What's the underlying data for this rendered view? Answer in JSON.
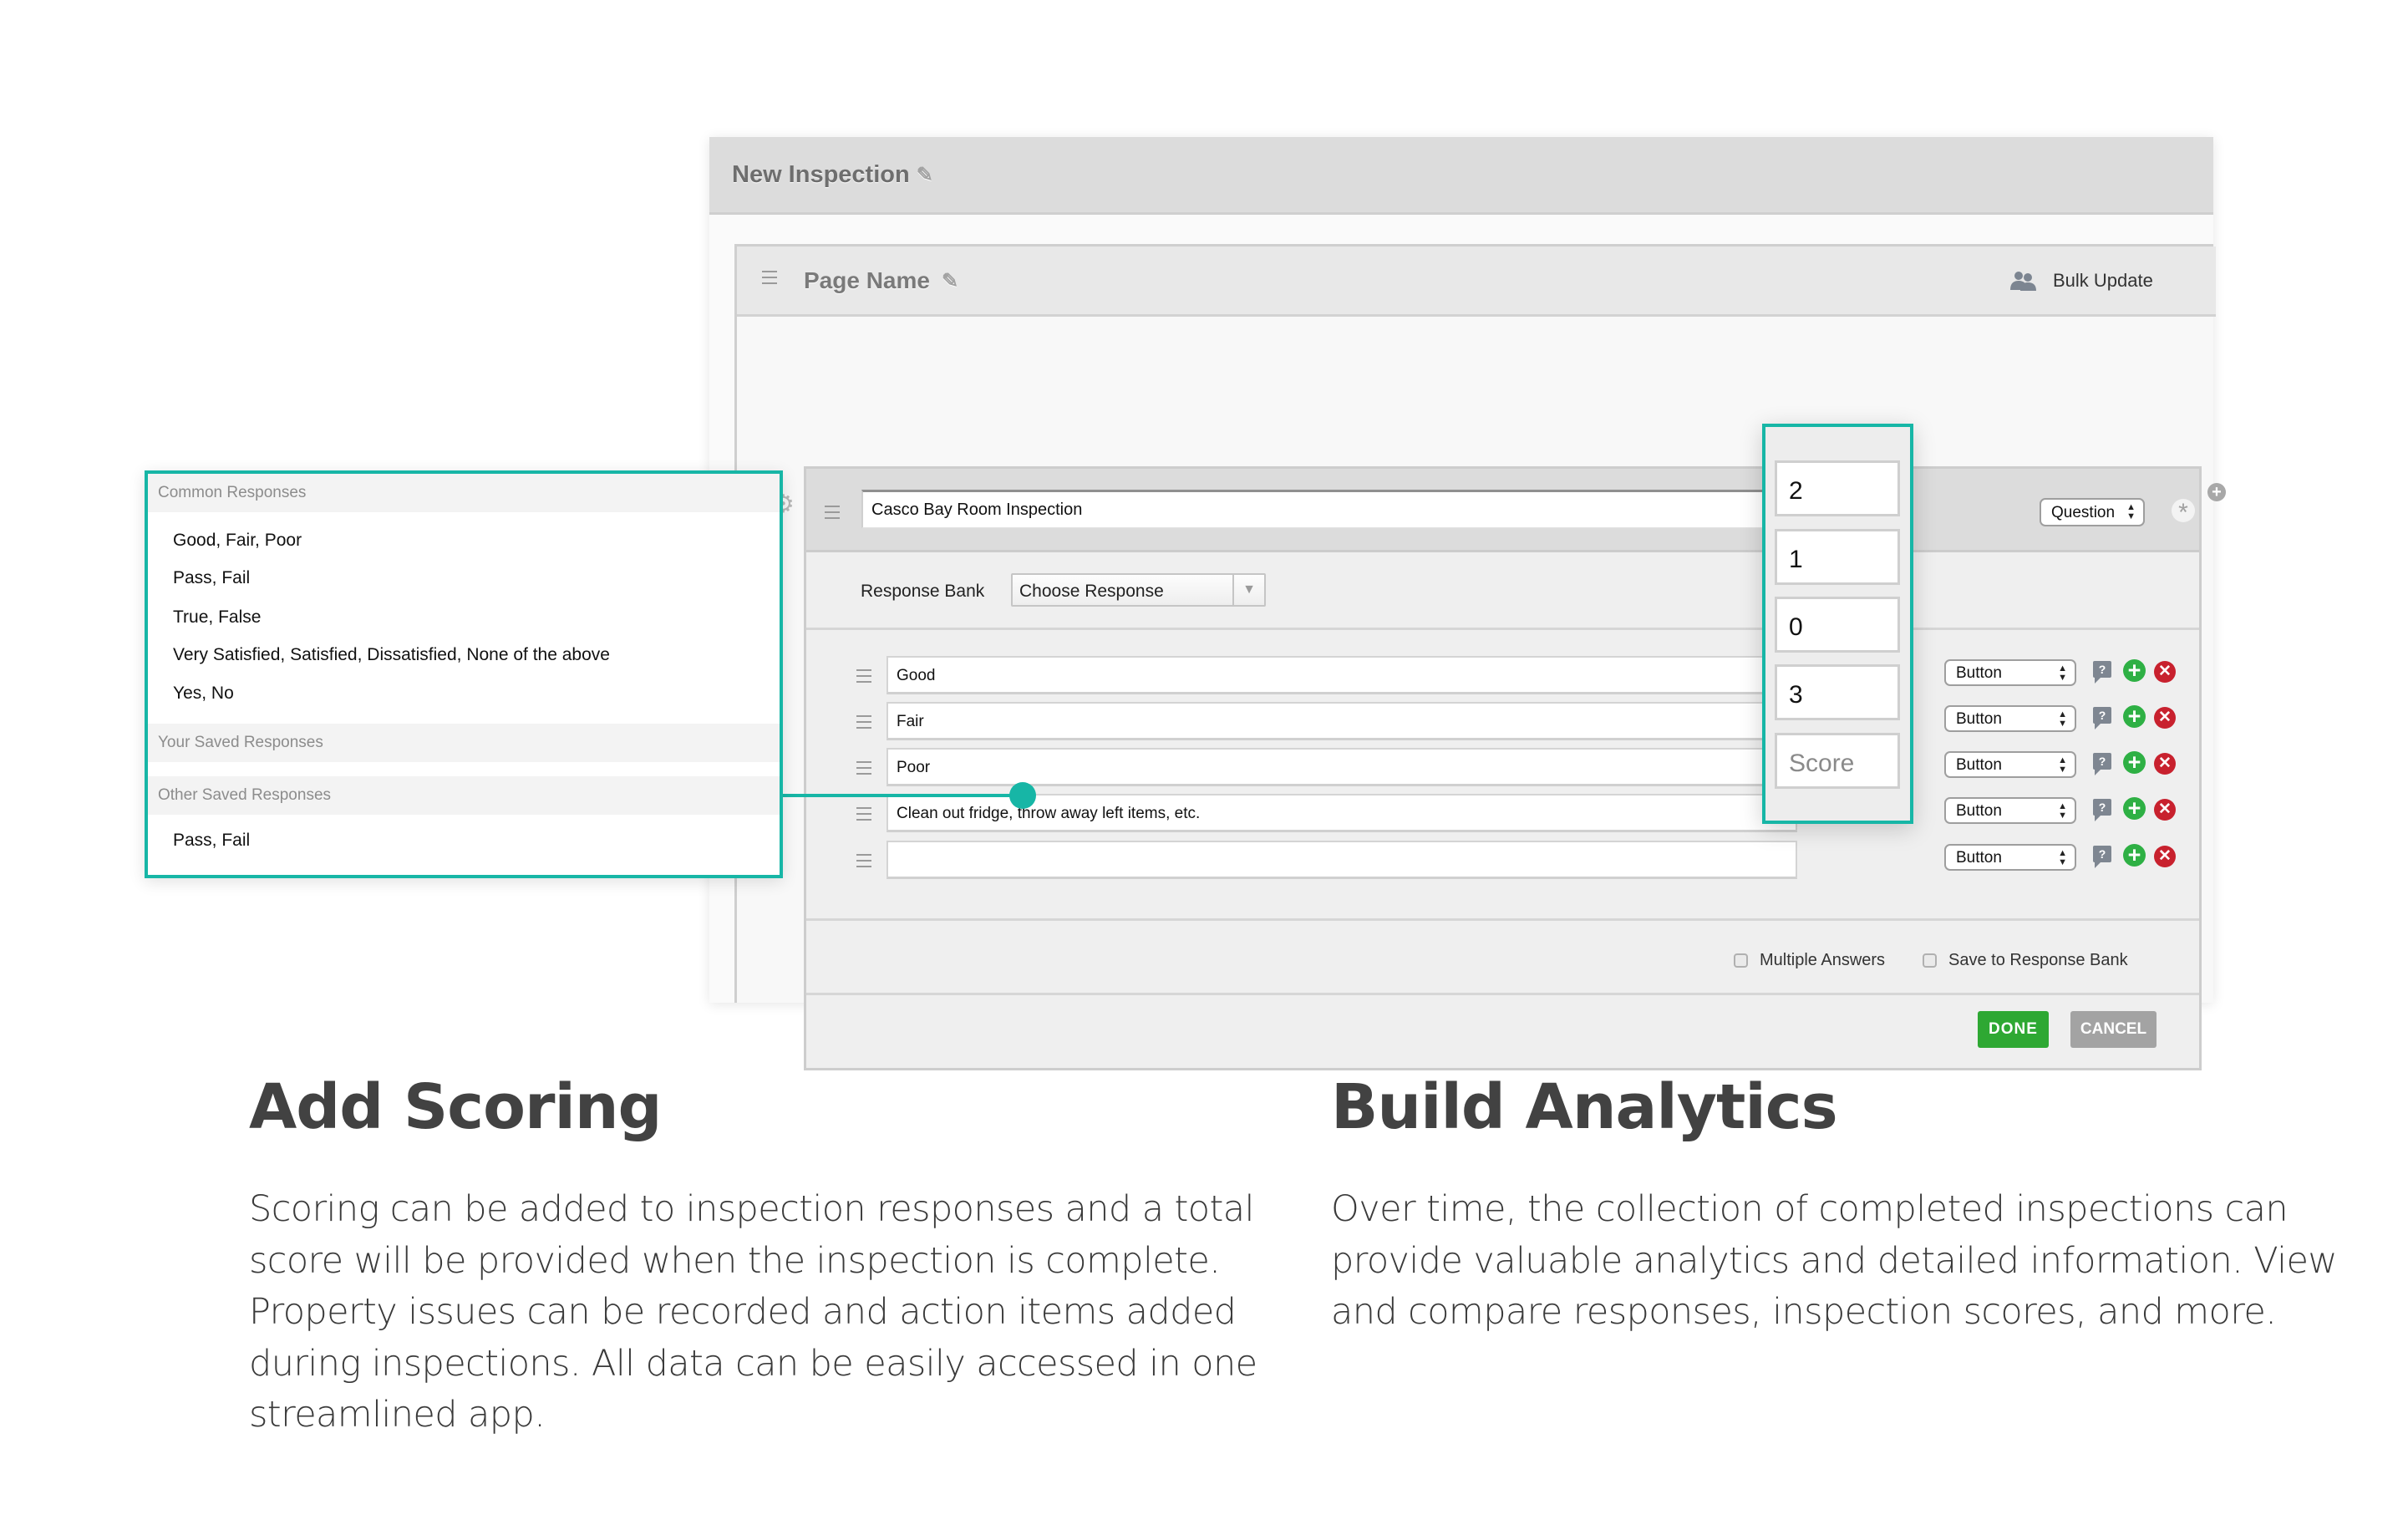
{
  "app": {
    "title": "New Inspection",
    "page_name": "Page Name",
    "bulk_update_label": "Bulk Update",
    "question": {
      "text": "Casco Bay Room Inspection",
      "type": "Question"
    },
    "response_bank": {
      "label": "Response Bank",
      "selected": "Choose Response"
    },
    "responses": [
      {
        "text": "Good",
        "type": "Button",
        "score": "2"
      },
      {
        "text": "Fair",
        "type": "Button",
        "score": "1"
      },
      {
        "text": "Poor",
        "type": "Button",
        "score": "0"
      },
      {
        "text": "Clean out fridge, throw away left items, etc.",
        "type": "Button",
        "score": "3"
      },
      {
        "text": "",
        "type": "Button",
        "score": ""
      }
    ],
    "score_placeholder": "Score",
    "options": {
      "multiple_answers": "Multiple Answers",
      "save_to_bank": "Save to Response Bank"
    },
    "buttons": {
      "done": "DONE",
      "cancel": "CANCEL"
    },
    "icons": {
      "edit": "pencil-icon",
      "drag": "drag-handle-icon",
      "settings": "gear-icon",
      "bulk": "people-icon",
      "help": "help-bubble-icon",
      "add": "plus-circle-icon",
      "remove": "x-circle-icon",
      "required": "asterisk-icon"
    },
    "colors": {
      "accent": "#17b6a6",
      "done": "#2ea833",
      "cancel": "#a3a3a3",
      "add": "#2eb044",
      "remove": "#c8212e"
    }
  },
  "dropdown": {
    "sections": [
      {
        "title": "Common Responses",
        "items": [
          "Good, Fair, Poor",
          "Pass, Fail",
          "True, False",
          "Very Satisfied, Satisfied, Dissatisfied, None of the above",
          "Yes, No"
        ]
      },
      {
        "title": "Your Saved Responses",
        "items": []
      },
      {
        "title": "Other Saved Responses",
        "items": [
          "Pass, Fail"
        ]
      }
    ]
  },
  "features": [
    {
      "title": "Add Scoring",
      "lines": [
        "Scoring can be added to inspection responses and a total",
        "score will be provided when the inspection is complete.",
        "Property issues can be recorded and action items added",
        "during inspections. All data can be easily accessed in one",
        "streamlined app."
      ]
    },
    {
      "title": "Build Analytics",
      "lines": [
        "Over time, the collection of completed inspections can",
        "provide valuable analytics and detailed information. View",
        "and compare responses, inspection scores, and more."
      ]
    }
  ]
}
